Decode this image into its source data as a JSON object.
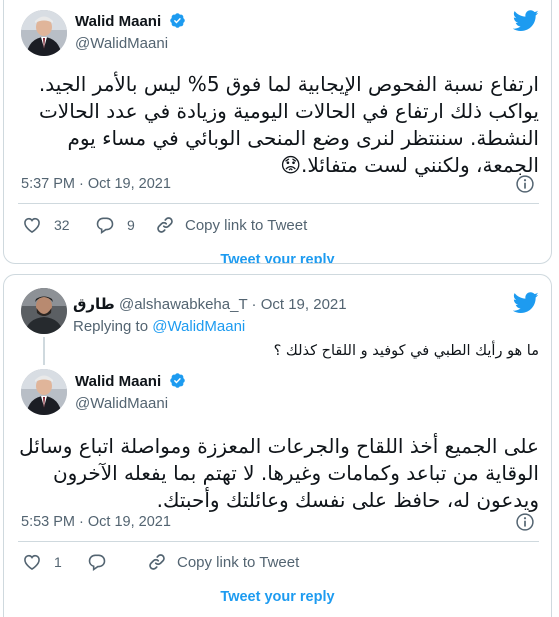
{
  "tweet1": {
    "author_name": "Walid Maani",
    "author_handle": "@WalidMaani",
    "text_lines": [
      "ارتفاع نسبة الفحوص الإيجابية لما فوق 5% ليس بالأمر الجيد.",
      "يواكب ذلك ارتفاع في الحالات اليومية وزيادة  في عدد الحالات",
      "النشطة. سننتظر لنرى وضع المنحى الوبائي في مساء يوم",
      "الجمعة، ولكنني لست متفائلا.😟"
    ],
    "timestamp": "5:37 PM · Oct 19, 2021",
    "likes": "32",
    "replies": "9",
    "copy_link_label": "Copy link to Tweet",
    "reply_label": "Tweet your reply"
  },
  "tweet2": {
    "parent": {
      "author_name": "طارق",
      "author_handle": "@alshawabkeha_T",
      "date": "Oct 19, 2021",
      "replying_prefix": "Replying to",
      "replying_to": "@WalidMaani",
      "text": "ما هو رأيك الطبي في كوفيد و اللقاح كذلك ؟"
    },
    "reply": {
      "author_name": "Walid Maani",
      "author_handle": "@WalidMaani",
      "text_lines": [
        "على الجميع أخذ اللقاح والجرعات المعززة ومواصلة اتباع وسائل",
        "الوقاية من تباعد وكمامات وغيرها. لا تهتم بما يفعله الآخرون",
        "ويدعون له، حافظ على نفسك وعائلتك وأحبتك."
      ],
      "timestamp": "5:53 PM · Oct 19, 2021",
      "likes": "1",
      "copy_link_label": "Copy link to Tweet",
      "reply_label": "Tweet your reply"
    }
  },
  "icons": {
    "brand": "twitter-bird-icon",
    "verified": "verified-badge-icon",
    "info": "info-icon",
    "like": "heart-icon",
    "reply": "reply-bubble-icon",
    "link": "link-icon"
  },
  "colors": {
    "twitter_blue": "#1d9bf0",
    "text_primary": "#0f1419",
    "text_secondary": "#536471",
    "border": "#cfd9de"
  }
}
